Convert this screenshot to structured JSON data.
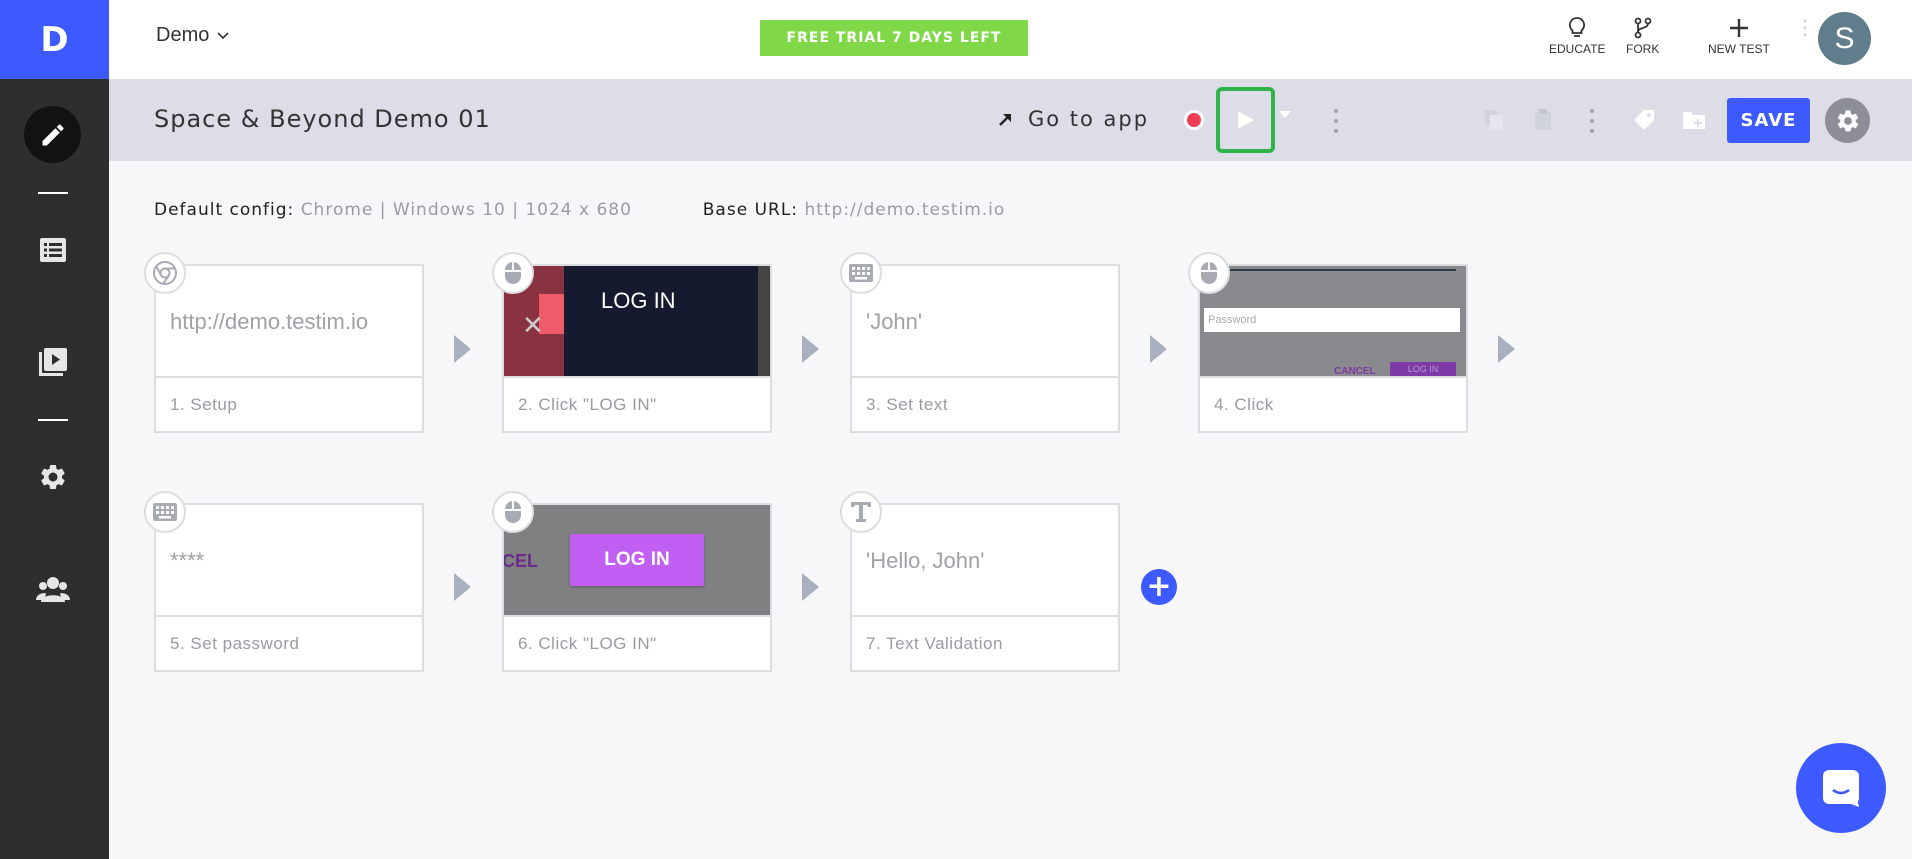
{
  "app": {
    "logo_letter": "D"
  },
  "topbar": {
    "project": "Demo",
    "trial_banner": "FREE TRIAL 7 DAYS LEFT",
    "actions": {
      "educate": "EDUCATE",
      "fork": "FORK",
      "new_test": "NEW TEST"
    },
    "avatar_initial": "S"
  },
  "toolbar": {
    "test_title": "Space & Beyond Demo 01",
    "go_to_app": "Go to app",
    "save_label": "SAVE"
  },
  "config": {
    "default_label": "Default config:",
    "default_value": "Chrome | Windows 10 | 1024 x 680",
    "base_url_label": "Base URL:",
    "base_url_value": "http://demo.testim.io"
  },
  "steps": [
    {
      "type": "browser",
      "preview_text": "http://demo.testim.io",
      "label": "1. Setup"
    },
    {
      "type": "click",
      "screenshot_text": "LOG IN",
      "label": "2. Click \"LOG IN\""
    },
    {
      "type": "keyboard",
      "preview_text": "'John'",
      "label": "3. Set text"
    },
    {
      "type": "click",
      "screenshot_text": "Password",
      "screenshot_cancel": "CANCEL",
      "screenshot_login": "LOG IN",
      "label": "4. Click"
    },
    {
      "type": "keyboard",
      "preview_text": "****",
      "label": "5. Set password"
    },
    {
      "type": "click",
      "screenshot_text": "LOG IN",
      "screenshot_partial": "CEL",
      "label": "6. Click \"LOG IN\""
    },
    {
      "type": "text",
      "preview_text": "'Hello, John'",
      "label": "7. Text Validation"
    }
  ],
  "colors": {
    "brand": "#3c5aff",
    "trial": "#80d849",
    "record": "#ef3f57",
    "highlight": "#2fb34a"
  }
}
